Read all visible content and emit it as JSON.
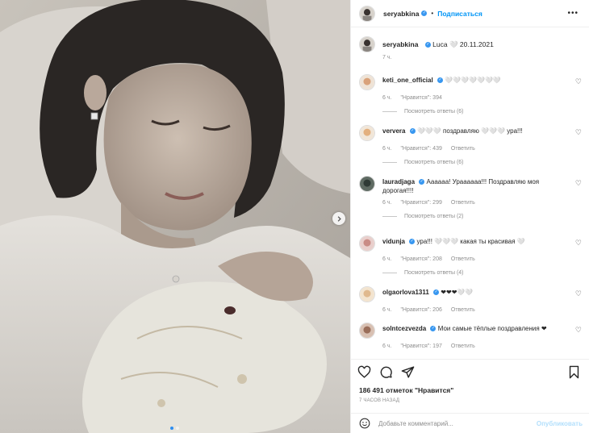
{
  "post_author": {
    "username": "seryabkina",
    "follow_label": "Подписаться",
    "separator": "•",
    "more": "•••"
  },
  "caption": {
    "username": "seryabkina",
    "text": "Luca 🤍 20.11.2021",
    "time": "7 ч."
  },
  "comments": [
    {
      "username": "keti_one_official",
      "text": "🤍🤍🤍🤍🤍🤍🤍",
      "time": "6 ч.",
      "likes": "\"Нравится\": 394",
      "reply": "",
      "view_replies": "Посмотреть ответы (6)",
      "avatar_color": "#d9a27a"
    },
    {
      "username": "ververa",
      "text": "🤍🤍🤍 поздравляю 🤍🤍🤍 ура!!!",
      "time": "6 ч.",
      "likes": "\"Нравится\": 439",
      "reply": "Ответить",
      "view_replies": "Посмотреть ответы (6)",
      "avatar_color": "#e3b07e"
    },
    {
      "username": "lauradjaga",
      "text": "Аааааа! Ураааааа!!! Поздравляю моя дорогая!!!!",
      "time": "6 ч.",
      "likes": "\"Нравится\": 299",
      "reply": "Ответить",
      "view_replies": "Посмотреть ответы (2)",
      "avatar_color": "#2f3a35"
    },
    {
      "username": "vidunja",
      "text": "ура!!! 🤍🤍🤍 какая ты красивая 🤍",
      "time": "6 ч.",
      "likes": "\"Нравится\": 208",
      "reply": "Ответить",
      "view_replies": "Посмотреть ответы (4)",
      "avatar_color": "#c98c86"
    },
    {
      "username": "olgaorlova1311",
      "text": "❤❤❤🤍🤍",
      "time": "6 ч.",
      "likes": "\"Нравится\": 206",
      "reply": "Ответить",
      "view_replies": "",
      "avatar_color": "#e0b98e"
    },
    {
      "username": "solntcezvezda",
      "text": "Мои самые тёплые поздравления ❤",
      "time": "6 ч.",
      "likes": "\"Нравится\": 197",
      "reply": "Ответить",
      "view_replies": "",
      "avatar_color": "#9a6e5a"
    }
  ],
  "likes_summary": "186 491 отметок \"Нравится\"",
  "posted_ago": "7 ЧАСОВ НАЗАД",
  "add_comment": {
    "placeholder": "Добавьте комментарий...",
    "post_label": "Опубликовать"
  },
  "colors": {
    "accent": "#0095f6",
    "verified": "#3897f0",
    "post_disabled": "#b2dffc",
    "carousel_active_dot": "#2e8ef0"
  },
  "icons": [
    "more-icon",
    "verified-icon",
    "heart-icon",
    "comment-icon",
    "share-icon",
    "bookmark-icon",
    "emoji-icon",
    "carousel-next-icon"
  ]
}
